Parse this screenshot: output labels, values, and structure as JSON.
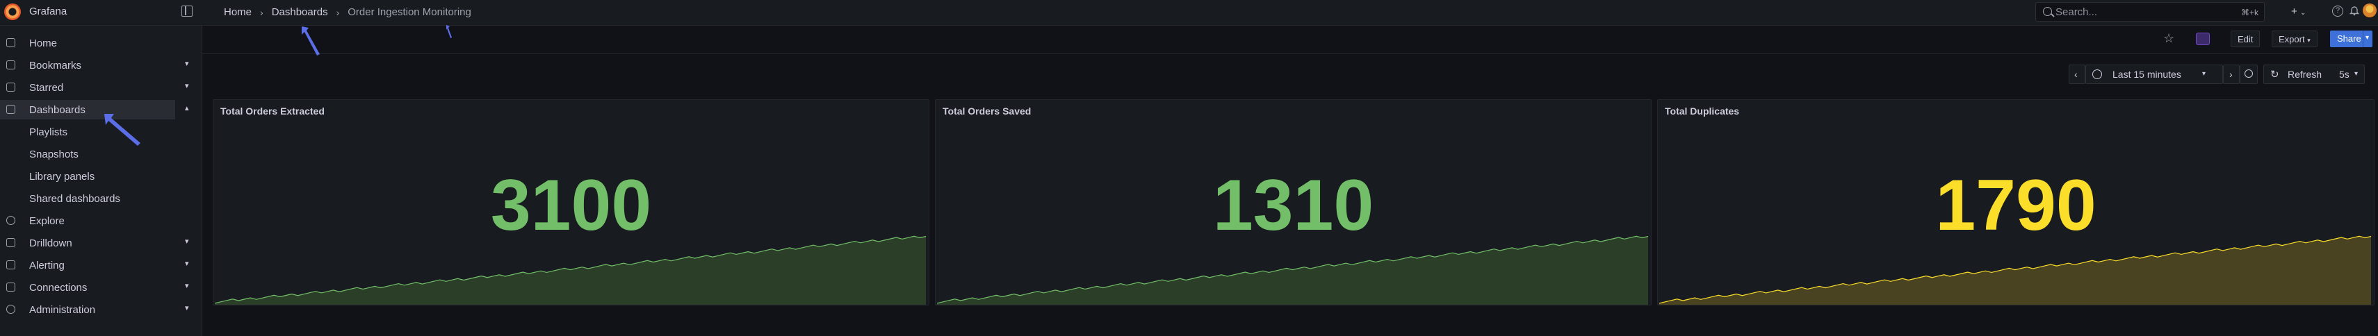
{
  "app": {
    "brand": "Grafana"
  },
  "breadcrumb": [
    {
      "label": "Home"
    },
    {
      "label": "Dashboards"
    },
    {
      "label": "Order Ingestion Monitoring"
    }
  ],
  "search": {
    "placeholder": "Search...",
    "shortcut": "⌘+k"
  },
  "topbar": {
    "plus_label": "+"
  },
  "sidebar": {
    "items": [
      {
        "label": "Home",
        "icon": "home-icon",
        "chevron": false
      },
      {
        "label": "Bookmarks",
        "icon": "bookmark-icon",
        "chevron": true
      },
      {
        "label": "Starred",
        "icon": "star-icon",
        "chevron": true
      },
      {
        "label": "Dashboards",
        "icon": "dashboards-icon",
        "chevron": true,
        "expanded": true
      },
      {
        "label": "Explore",
        "icon": "compass-icon",
        "chevron": false
      },
      {
        "label": "Drilldown",
        "icon": "drilldown-icon",
        "chevron": true
      },
      {
        "label": "Alerting",
        "icon": "bell-icon",
        "chevron": true
      },
      {
        "label": "Connections",
        "icon": "plug-icon",
        "chevron": true
      },
      {
        "label": "Administration",
        "icon": "gear-icon",
        "chevron": true
      }
    ],
    "dashboards_children": [
      {
        "label": "Playlists"
      },
      {
        "label": "Snapshots"
      },
      {
        "label": "Library panels"
      },
      {
        "label": "Shared dashboards"
      }
    ]
  },
  "toolbar": {
    "edit_label": "Edit",
    "export_label": "Export",
    "share_label": "Share"
  },
  "time_controls": {
    "range_label": "Last 15 minutes",
    "refresh_label": "Refresh",
    "interval_label": "5s"
  },
  "colors": {
    "green": "#73bf69",
    "yellow": "#fade2a",
    "accent_blue": "#3d71d9",
    "annotation_arrow": "#5b6ee8"
  },
  "panels": [
    {
      "title": "Total Orders Extracted",
      "value": "3100",
      "color": "#73bf69",
      "fill": "#2b3f28"
    },
    {
      "title": "Total Orders Saved",
      "value": "1310",
      "color": "#73bf69",
      "fill": "#2b3f28"
    },
    {
      "title": "Total Duplicates",
      "value": "1790",
      "color": "#fade2a",
      "fill": "#4a4322"
    }
  ]
}
